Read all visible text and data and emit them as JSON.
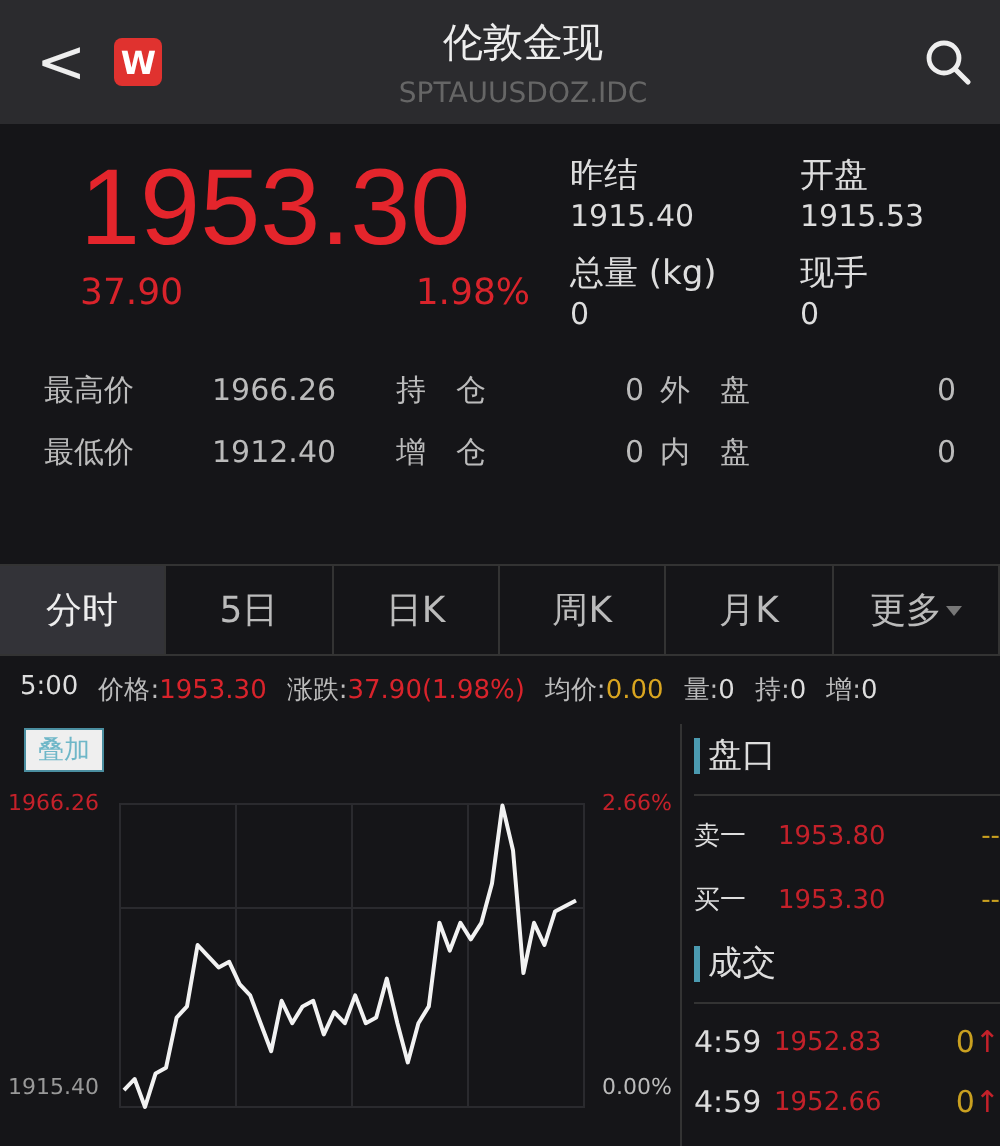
{
  "header": {
    "back": "<",
    "logo": "W",
    "title": "伦敦金现",
    "code": "SPTAUUSDOZ.IDC"
  },
  "quote": {
    "price": "1953.30",
    "change": "37.90",
    "percent": "1.98%",
    "stats": [
      {
        "label": "昨结",
        "value": "1915.40"
      },
      {
        "label": "开盘",
        "value": "1915.53"
      },
      {
        "label": "总量 (kg)",
        "value": "0"
      },
      {
        "label": "现手",
        "value": "0"
      }
    ]
  },
  "details": [
    {
      "label": "最高价",
      "value": "1966.26",
      "label2": "持　仓",
      "value2": "0",
      "label3": "外　盘",
      "value3": "0"
    },
    {
      "label": "最低价",
      "value": "1912.40",
      "label2": "增　仓",
      "value2": "0",
      "label3": "内　盘",
      "value3": "0"
    }
  ],
  "tabs": [
    {
      "label": "分时",
      "selected": true,
      "dropdown": false
    },
    {
      "label": "5日",
      "selected": false,
      "dropdown": false
    },
    {
      "label": "日K",
      "selected": false,
      "dropdown": false
    },
    {
      "label": "周K",
      "selected": false,
      "dropdown": false
    },
    {
      "label": "月K",
      "selected": false,
      "dropdown": false
    },
    {
      "label": "更多",
      "selected": false,
      "dropdown": true
    }
  ],
  "infobar": [
    {
      "label": "5:00",
      "color": "#dddddd"
    },
    {
      "label": "价格:",
      "value": "1953.30",
      "color": "#d9232b"
    },
    {
      "label": "涨跌:",
      "value": "37.90(1.98%)",
      "color": "#d9232b"
    },
    {
      "label": "均价:",
      "value": "0.00",
      "color": "#d9a520"
    },
    {
      "label": "量:",
      "value": "0",
      "color": "#dddddd"
    },
    {
      "label": "持:",
      "value": "0",
      "color": "#dddddd"
    },
    {
      "label": "增:",
      "value": "0",
      "color": "#dddddd"
    }
  ],
  "chart": {
    "overlay": "叠加",
    "high_pct": "2.66%",
    "base_pct": "0.00%",
    "chart_data": {
      "type": "line",
      "ylim": [
        1912,
        1966.26
      ],
      "yticks": [
        {
          "value": 1966.26,
          "label": "1966.26"
        },
        {
          "value": 1915.4,
          "label": "1915.40"
        }
      ],
      "series": [
        {
          "color": "#f2f2f2",
          "values": [
            1915,
            1917,
            1912,
            1918,
            1919,
            1928,
            1930,
            1941,
            1939,
            1937,
            1938,
            1934,
            1932,
            1927,
            1922,
            1931,
            1927,
            1930,
            1931,
            1925,
            1929,
            1927,
            1932,
            1927,
            1928,
            1935,
            1927,
            1920,
            1927,
            1930,
            1945,
            1940,
            1945,
            1942,
            1945,
            1952,
            1966,
            1958,
            1936,
            1945,
            1941,
            1947,
            1948,
            1949
          ]
        }
      ]
    }
  },
  "orderbook": {
    "title": "盘口",
    "rows": [
      {
        "label": "卖一",
        "price": "1953.80",
        "volume": "--"
      },
      {
        "label": "买一",
        "price": "1953.30",
        "volume": "--"
      }
    ]
  },
  "trades": {
    "title": "成交",
    "rows": [
      {
        "time": "4:59",
        "price": "1952.83",
        "volume": "0",
        "arrow": "↑"
      },
      {
        "time": "4:59",
        "price": "1952.66",
        "volume": "0",
        "arrow": "↑"
      }
    ]
  }
}
